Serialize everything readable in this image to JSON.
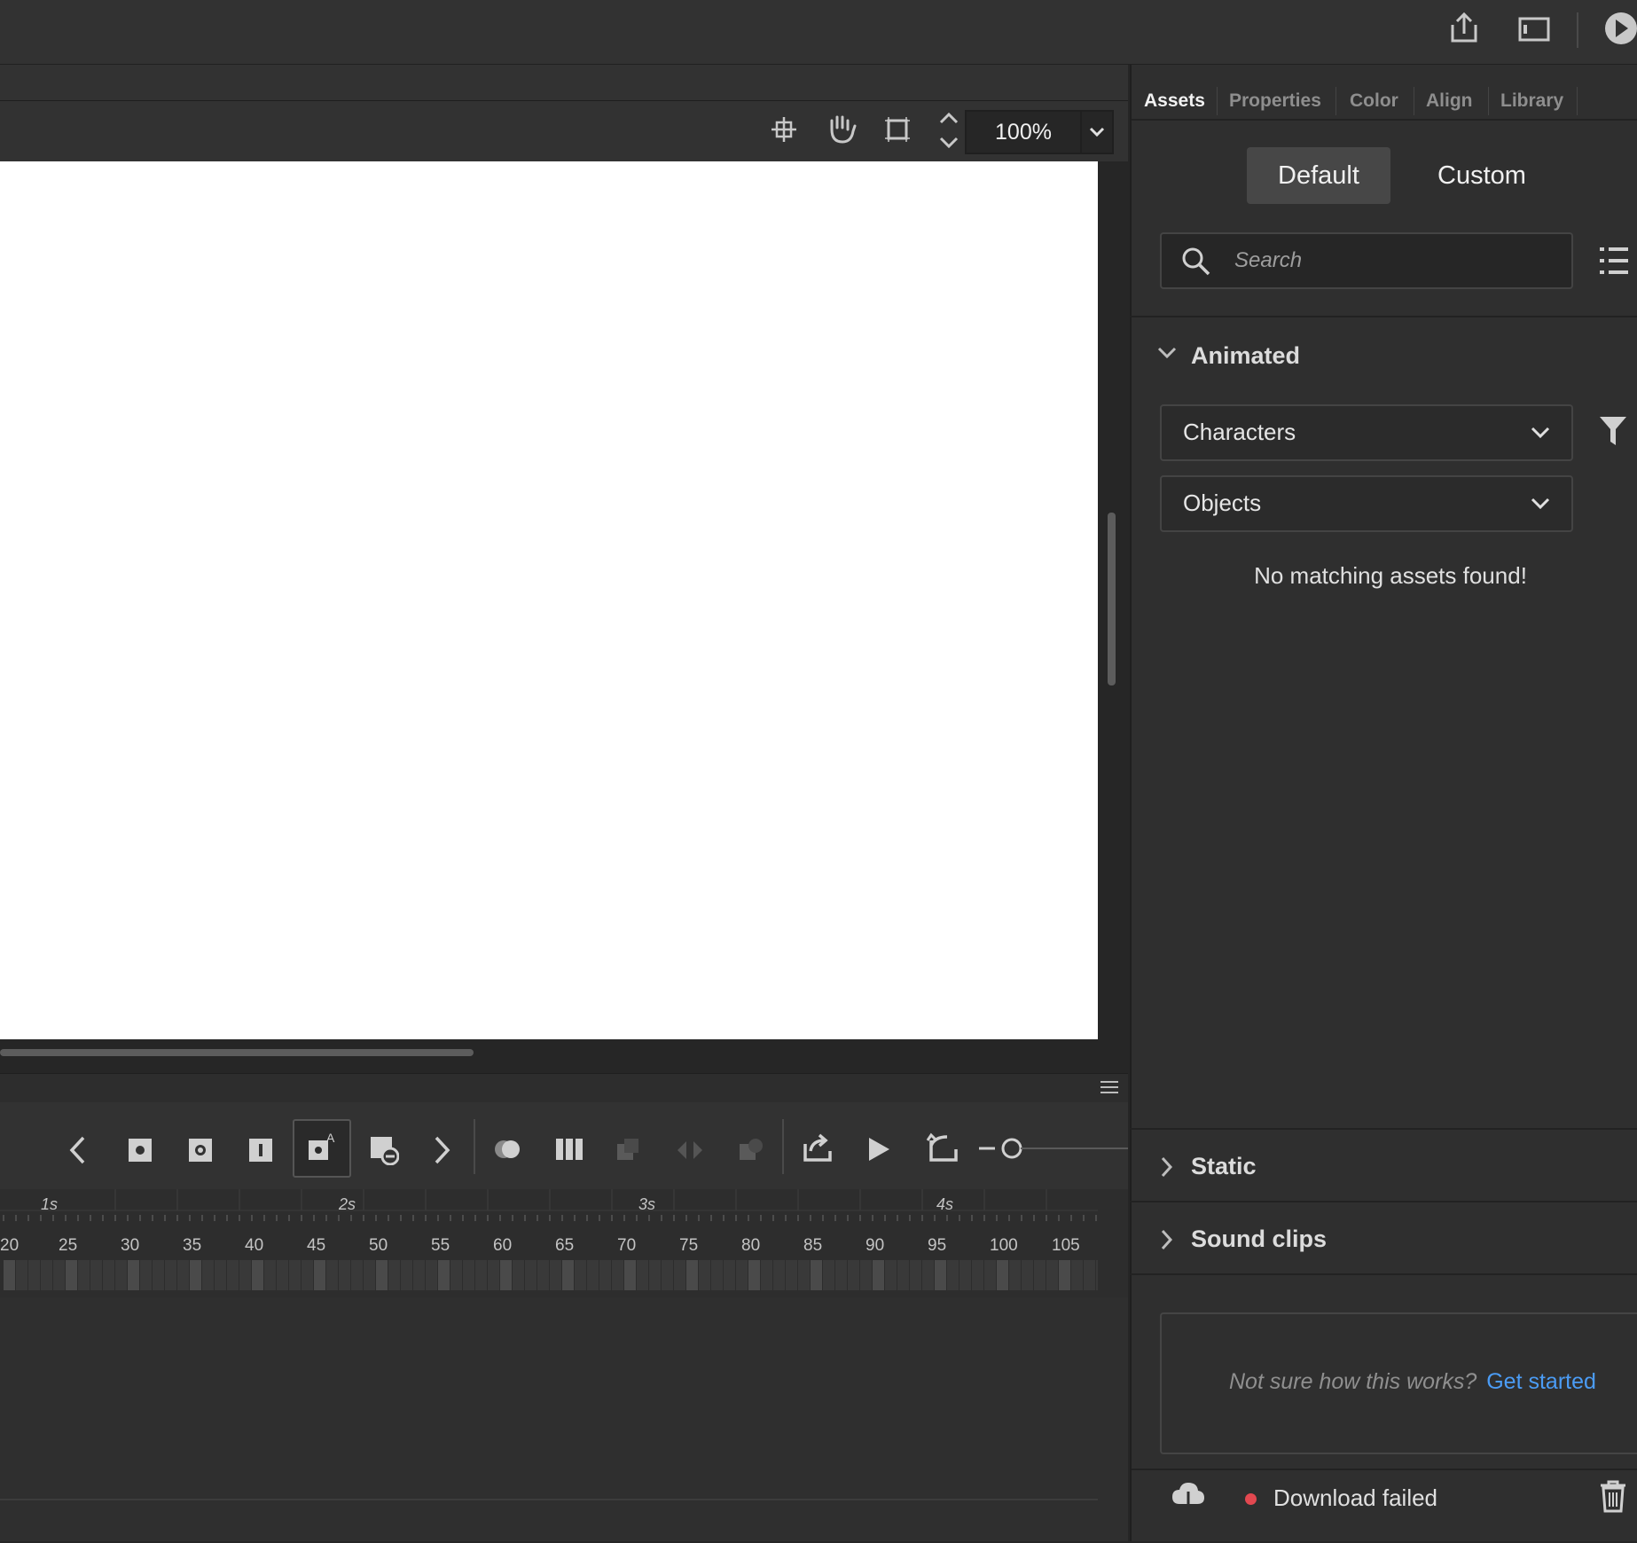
{
  "stage_toolbar": {
    "zoom_value": "100%"
  },
  "panel": {
    "tabs": [
      {
        "label": "Assets",
        "active": true
      },
      {
        "label": "Properties",
        "active": false
      },
      {
        "label": "Color",
        "active": false
      },
      {
        "label": "Align",
        "active": false
      },
      {
        "label": "Library",
        "active": false
      }
    ],
    "segments": {
      "default_label": "Default",
      "custom_label": "Custom"
    },
    "search": {
      "placeholder": "Search"
    },
    "animated": {
      "label": "Animated",
      "expanded": true,
      "dropdowns": [
        {
          "selected": "Characters"
        },
        {
          "selected": "Objects"
        }
      ],
      "empty_message": "No matching assets found!"
    },
    "static": {
      "label": "Static",
      "expanded": false
    },
    "sound_clips": {
      "label": "Sound clips",
      "expanded": false
    },
    "help": {
      "text": "Not sure how this works?",
      "link": "Get started"
    },
    "status": {
      "text": "Download failed",
      "color": "#e34850"
    }
  },
  "timeline": {
    "seconds": [
      "1s",
      "2s",
      "3s",
      "4s"
    ],
    "frames": [
      "20",
      "25",
      "30",
      "35",
      "40",
      "45",
      "50",
      "55",
      "60",
      "65",
      "70",
      "75",
      "80",
      "85",
      "90",
      "95",
      "100",
      "105"
    ]
  },
  "colors": {
    "accent_link": "#4b9cf5",
    "stage": "#ffffff",
    "panel_bg": "#2f2f2f"
  }
}
